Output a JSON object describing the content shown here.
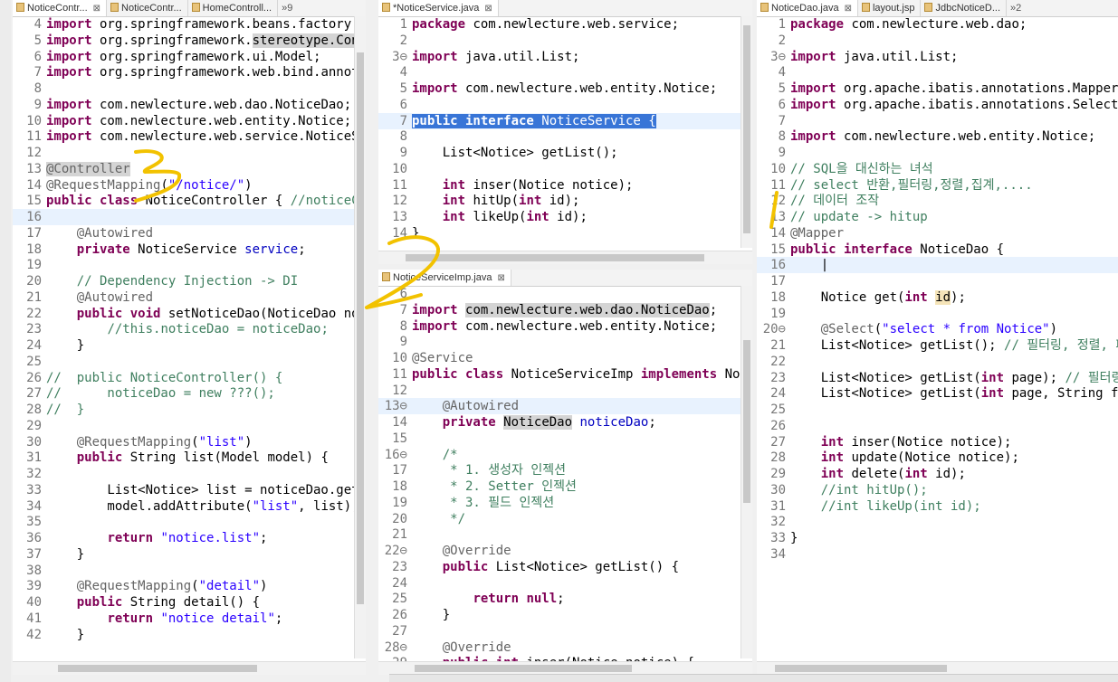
{
  "panes": {
    "left": {
      "tabs": [
        {
          "label": "NoticeContr...",
          "close": "⊠",
          "active": true
        },
        {
          "label": "NoticeContr...",
          "active": false
        },
        {
          "label": "HomeControll...",
          "active": false
        },
        {
          "label": "»9",
          "active": false
        }
      ],
      "lines": [
        {
          "n": "4",
          "h": "<span class='kw'>import</span> org.springframework.beans.factory.a"
        },
        {
          "n": "5",
          "h": "<span class='kw'>import</span> org.springframework.<span class='occ'>stereotype.Cont</span>"
        },
        {
          "n": "6",
          "h": "<span class='kw'>import</span> org.springframework.ui.Model;"
        },
        {
          "n": "7",
          "h": "<span class='kw'>import</span> org.springframework.web.bind.annota"
        },
        {
          "n": "8",
          "h": ""
        },
        {
          "n": "9",
          "h": "<span class='kw'>import</span> com.newlecture.web.dao.NoticeDao;"
        },
        {
          "n": "10",
          "h": "<span class='kw'>import</span> com.newlecture.web.entity.Notice;"
        },
        {
          "n": "11",
          "h": "<span class='kw'>import</span> com.newlecture.web.service.NoticeSe"
        },
        {
          "n": "12",
          "h": ""
        },
        {
          "n": "13",
          "h": "<span class='an occ'>@Controller</span>"
        },
        {
          "n": "14",
          "h": "<span class='an'>@RequestMapping</span>(<span class='st'>\"/notice/\"</span>)"
        },
        {
          "n": "15",
          "h": "<span class='kw'>public class</span> NoticeController { <span class='cm'>//noticeCo</span>"
        },
        {
          "n": "16",
          "h": "",
          "cur": true
        },
        {
          "n": "17",
          "h": "    <span class='an'>@Autowired</span>"
        },
        {
          "n": "18",
          "h": "    <span class='kw'>private</span> NoticeService <span class='fd'>service</span>;"
        },
        {
          "n": "19",
          "h": ""
        },
        {
          "n": "20",
          "h": "    <span class='cm'>// Dependency Injection -&gt; DI</span>"
        },
        {
          "n": "21",
          "h": "    <span class='an'>@Autowired</span>"
        },
        {
          "n": "22",
          "h": "    <span class='kw'>public void</span> setNoticeDao(NoticeDao not"
        },
        {
          "n": "23",
          "h": "        <span class='cm'>//this.noticeDao = noticeDao;</span>"
        },
        {
          "n": "24",
          "h": "    }"
        },
        {
          "n": "25",
          "h": ""
        },
        {
          "n": "26",
          "h": "<span class='cm'>//  public NoticeController() {</span>"
        },
        {
          "n": "27",
          "h": "<span class='cm'>//      noticeDao = new ???();</span>"
        },
        {
          "n": "28",
          "h": "<span class='cm'>//  }</span>"
        },
        {
          "n": "29",
          "h": ""
        },
        {
          "n": "30",
          "h": "    <span class='an'>@RequestMapping</span>(<span class='st'>\"list\"</span>)"
        },
        {
          "n": "31",
          "h": "    <span class='kw'>public</span> String list(Model model) {"
        },
        {
          "n": "32",
          "h": ""
        },
        {
          "n": "33",
          "h": "        List&lt;Notice&gt; list = noticeDao.getL"
        },
        {
          "n": "34",
          "h": "        model.addAttribute(<span class='st'>\"list\"</span>, list);"
        },
        {
          "n": "35",
          "h": ""
        },
        {
          "n": "36",
          "h": "        <span class='kw'>return</span> <span class='st'>\"notice.list\"</span>;"
        },
        {
          "n": "37",
          "h": "    }"
        },
        {
          "n": "38",
          "h": ""
        },
        {
          "n": "39",
          "h": "    <span class='an'>@RequestMapping</span>(<span class='st'>\"detail\"</span>)"
        },
        {
          "n": "40",
          "h": "    <span class='kw'>public</span> String detail() {"
        },
        {
          "n": "41",
          "h": "        <span class='kw'>return</span> <span class='st'>\"notice detail\"</span>;"
        },
        {
          "n": "42",
          "h": "    }"
        }
      ]
    },
    "middleTop": {
      "tabs": [
        {
          "label": "*NoticeService.java",
          "close": "⊠",
          "active": true
        }
      ],
      "lines": [
        {
          "n": "1",
          "h": "<span class='kw'>package</span> com.newlecture.web.service;"
        },
        {
          "n": "2",
          "h": ""
        },
        {
          "n": "3⊖",
          "h": "<span class='kw'>import</span> java.util.List;"
        },
        {
          "n": "4",
          "h": ""
        },
        {
          "n": "5",
          "h": "<span class='kw'>import</span> com.newlecture.web.entity.Notice;"
        },
        {
          "n": "6",
          "h": ""
        },
        {
          "n": "7",
          "h": "<span class='sel'><span class='kw'>public interface</span> NoticeService {</span>",
          "cur": true
        },
        {
          "n": "8",
          "h": ""
        },
        {
          "n": "9",
          "h": "    List&lt;Notice&gt; getList();"
        },
        {
          "n": "10",
          "h": ""
        },
        {
          "n": "11",
          "h": "    <span class='kw'>int</span> inser(Notice notice);"
        },
        {
          "n": "12",
          "h": "    <span class='kw'>int</span> hitUp(<span class='kw'>int</span> id);"
        },
        {
          "n": "13",
          "h": "    <span class='kw'>int</span> likeUp(<span class='kw'>int</span> id);"
        },
        {
          "n": "14",
          "h": "}"
        }
      ]
    },
    "middleBottom": {
      "tabs": [
        {
          "label": "NoticeServiceImp.java",
          "close": "⊠",
          "active": true
        }
      ],
      "lines": [
        {
          "n": "6",
          "h": ""
        },
        {
          "n": "7",
          "h": "<span class='kw'>import</span> <span class='occ'>com.newlecture.web.dao.NoticeDao</span>;"
        },
        {
          "n": "8",
          "h": "<span class='kw'>import</span> com.newlecture.web.entity.Notice;"
        },
        {
          "n": "9",
          "h": ""
        },
        {
          "n": "10",
          "h": "<span class='an'>@Service</span>"
        },
        {
          "n": "11",
          "h": "<span class='kw'>public class</span> NoticeServiceImp <span class='kw'>implements</span> Not"
        },
        {
          "n": "12",
          "h": ""
        },
        {
          "n": "13⊖",
          "h": "    <span class='an'>@Autowired</span>",
          "cur": true
        },
        {
          "n": "14",
          "h": "    <span class='kw'>private</span> <span class='occ'>NoticeDao</span> <span class='fd'>noticeDao</span>;"
        },
        {
          "n": "15",
          "h": ""
        },
        {
          "n": "16⊖",
          "h": "    <span class='cm'>/*</span>"
        },
        {
          "n": "17",
          "h": "<span class='cm'>     * 1. 생성자 인젝션</span>"
        },
        {
          "n": "18",
          "h": "<span class='cm'>     * 2. Setter 인젝션</span>"
        },
        {
          "n": "19",
          "h": "<span class='cm'>     * 3. 필드 인젝션</span>"
        },
        {
          "n": "20",
          "h": "<span class='cm'>     */</span>"
        },
        {
          "n": "21",
          "h": ""
        },
        {
          "n": "22⊖",
          "h": "    <span class='an'>@Override</span>"
        },
        {
          "n": "23",
          "h": "    <span class='kw'>public</span> List&lt;Notice&gt; getList() {"
        },
        {
          "n": "24",
          "h": ""
        },
        {
          "n": "25",
          "h": "        <span class='kw'>return null</span>;"
        },
        {
          "n": "26",
          "h": "    }"
        },
        {
          "n": "27",
          "h": ""
        },
        {
          "n": "28⊖",
          "h": "    <span class='an'>@Override</span>"
        },
        {
          "n": "29",
          "h": "    <span class='kw'>public int</span> inser(Notice notice) {"
        }
      ]
    },
    "right": {
      "tabs": [
        {
          "label": "NoticeDao.java",
          "close": "⊠",
          "active": true
        },
        {
          "label": "layout.jsp",
          "active": false
        },
        {
          "label": "JdbcNoticeD...",
          "active": false
        },
        {
          "label": "»2",
          "active": false
        }
      ],
      "lines": [
        {
          "n": "1",
          "h": "<span class='kw'>package</span> com.newlecture.web.dao;"
        },
        {
          "n": "2",
          "h": ""
        },
        {
          "n": "3⊖",
          "h": "<span class='kw'>import</span> java.util.List;"
        },
        {
          "n": "4",
          "h": ""
        },
        {
          "n": "5",
          "h": "<span class='kw'>import</span> org.apache.ibatis.annotations.Mapper;"
        },
        {
          "n": "6",
          "h": "<span class='kw'>import</span> org.apache.ibatis.annotations.Select;"
        },
        {
          "n": "7",
          "h": ""
        },
        {
          "n": "8",
          "h": "<span class='kw'>import</span> com.newlecture.web.entity.Notice;"
        },
        {
          "n": "9",
          "h": ""
        },
        {
          "n": "10",
          "h": "<span class='cm'>// SQL을 대신하는 녀석</span>"
        },
        {
          "n": "11",
          "h": "<span class='cm'>// select 반환,필터링,정렬,집계,....</span>"
        },
        {
          "n": "12",
          "h": "<span class='cm'>// 데이터 조작</span>"
        },
        {
          "n": "13",
          "h": "<span class='cm'>// update -&gt; hitup</span>"
        },
        {
          "n": "14",
          "h": "<span class='an'>@Mapper</span>"
        },
        {
          "n": "15",
          "h": "<span class='kw'>public interface</span> NoticeDao {"
        },
        {
          "n": "16",
          "h": "    |",
          "cur": true
        },
        {
          "n": "17",
          "h": ""
        },
        {
          "n": "18",
          "h": "    Notice get(<span class='kw'>int</span> <span class='occ2'>id</span>);"
        },
        {
          "n": "19",
          "h": ""
        },
        {
          "n": "20⊖",
          "h": "    <span class='an'>@Select</span>(<span class='st'>\"select * from Notice\"</span>)"
        },
        {
          "n": "21",
          "h": "    List&lt;Notice&gt; getList(); <span class='cm'>// 필터링, 정렬, 페</span>"
        },
        {
          "n": "22",
          "h": ""
        },
        {
          "n": "23",
          "h": "    List&lt;Notice&gt; getList(<span class='kw'>int</span> page); <span class='cm'>// 필터링</span>"
        },
        {
          "n": "24",
          "h": "    List&lt;Notice&gt; getList(<span class='kw'>int</span> page, String fi"
        },
        {
          "n": "25",
          "h": ""
        },
        {
          "n": "26",
          "h": ""
        },
        {
          "n": "27",
          "h": "    <span class='kw'>int</span> inser(Notice notice);"
        },
        {
          "n": "28",
          "h": "    <span class='kw'>int</span> update(Notice notice);"
        },
        {
          "n": "29",
          "h": "    <span class='kw'>int</span> delete(<span class='kw'>int</span> id);"
        },
        {
          "n": "30",
          "h": "    <span class='cm'>//int hitUp();</span>"
        },
        {
          "n": "31",
          "h": "    <span class='cm'>//int likeUp(int id);</span>"
        },
        {
          "n": "32",
          "h": ""
        },
        {
          "n": "33",
          "h": "}"
        },
        {
          "n": "34",
          "h": ""
        }
      ]
    }
  },
  "colors": {
    "keyword": "#7f0055",
    "comment": "#3f7f5f",
    "string": "#2a00ff",
    "annotation": "#646464",
    "selection": "#3875d7",
    "currentLine": "#e8f2fe",
    "pen": "#f2c200"
  }
}
